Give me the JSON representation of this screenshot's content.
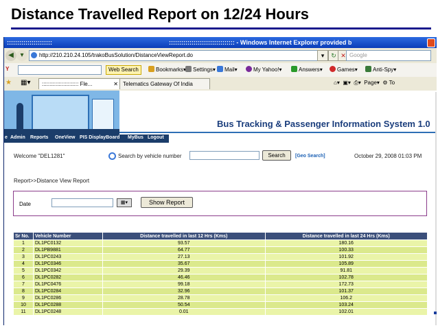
{
  "slide": {
    "title": "Distance Travelled Report on 12/24 Hours"
  },
  "browser": {
    "window_title_dots": "::::::::::::::::::::::",
    "window_title": ":::::::::::::::::::::::::::::::: - Windows Internet Explorer provided b",
    "url": "http://210.210.24.105/trakoBusSolution/DistanceViewReport.do",
    "search_placeholder": "Google",
    "toolbar": {
      "web_search": "Web Search",
      "bookmarks": "Bookmarks",
      "settings": "Settings",
      "mail": "Mail",
      "my_yahoo": "My Yahoo!",
      "answers": "Answers",
      "games": "Games",
      "anti_spy": "Anti-Spy"
    },
    "tabs": [
      {
        "label": ":::::::::::::::::::::::: Fle..."
      },
      {
        "label": "Telematics Gateway Of India"
      }
    ],
    "tab_tools": {
      "page": "Page",
      "tools": "To"
    }
  },
  "page": {
    "banner_title": "Bus Tracking & Passenger Information System 1.0",
    "menu": [
      "e",
      "Admin",
      "Reports",
      "OneView",
      "PIS DisplayBoard",
      "MyBus",
      "Logout"
    ],
    "welcome": "Welcome \"DEL1281\"",
    "search_label": "Search by vehicle number",
    "search_button": "Search",
    "geo_search": "[Geo Search]",
    "datetime": "October 29, 2008 01:03 PM",
    "breadcrumb": "Report>>Distance View Report",
    "date_label": "Date",
    "show_report": "Show Report"
  },
  "report_table": {
    "columns": [
      "Sr No.",
      "Vehicle Number",
      "Distance travelled in last 12 Hrs (Kms)",
      "Distance travelled in last 24 Hrs (Kms)"
    ],
    "rows": [
      [
        "1",
        "DL1PC0132",
        "93.57",
        "180.16"
      ],
      [
        "2",
        "DL1PB9881",
        "64.77",
        "100.33"
      ],
      [
        "3",
        "DL1PC0243",
        "27.13",
        "101.92"
      ],
      [
        "4",
        "DL1PC0346",
        "35.67",
        "105.89"
      ],
      [
        "5",
        "DL1PC0342",
        "29.39",
        "91.81"
      ],
      [
        "6",
        "DL1PC0282",
        "46.46",
        "102.78"
      ],
      [
        "7",
        "DL1PC0476",
        "99.18",
        "172.73"
      ],
      [
        "8",
        "DL1PC0284",
        "32.96",
        "101.37"
      ],
      [
        "9",
        "DL1PC0286",
        "28.78",
        "106.2"
      ],
      [
        "10",
        "DL1PC0288",
        "50.54",
        "103.24"
      ],
      [
        "11",
        "DL1PC0248",
        "0.01",
        "102.01"
      ]
    ]
  },
  "colors": {
    "accent": "#1a3d7c",
    "table_header": "#3b4f7a",
    "row_light": "#eaf4a8",
    "row_dark": "#dbe98c"
  }
}
